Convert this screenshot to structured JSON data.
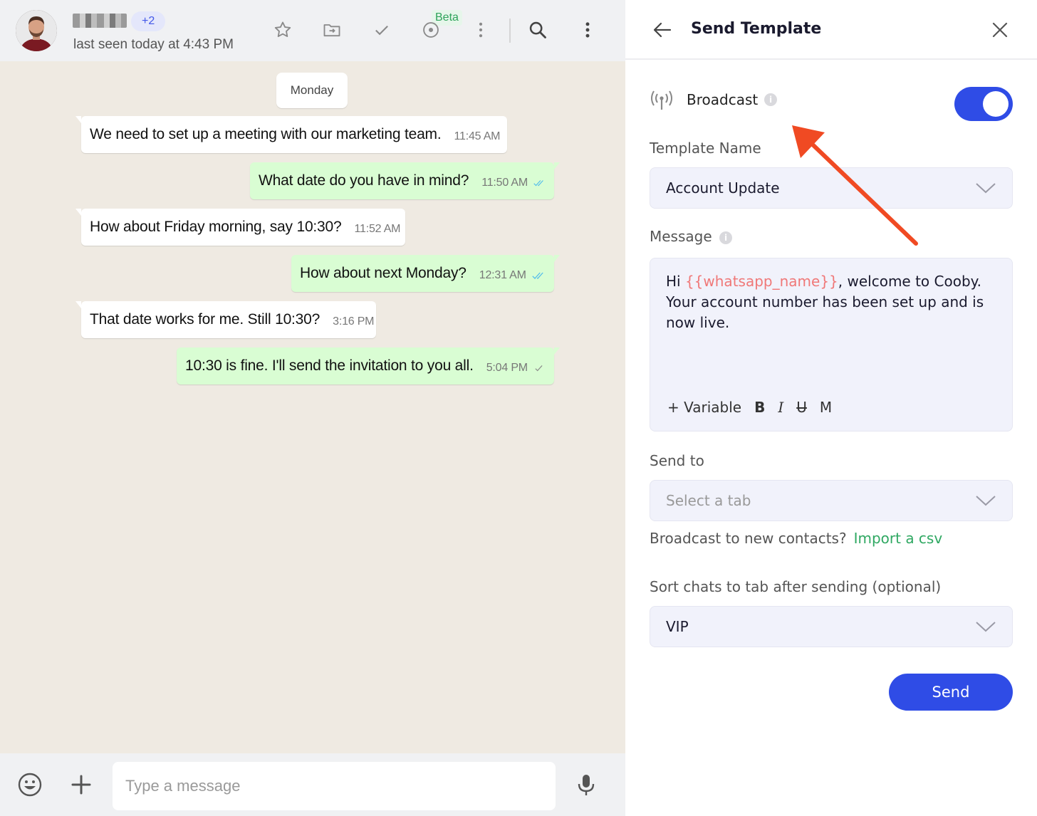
{
  "chat": {
    "header": {
      "extra_participants": "+2",
      "last_seen": "last seen today at 4:43 PM",
      "beta_label": "Beta",
      "icons": [
        "star-icon",
        "move-to-folder-icon",
        "checkmark-icon",
        "target-icon",
        "more-vertical-icon",
        "search-icon",
        "more-vertical-icon"
      ]
    },
    "day_label": "Monday",
    "messages": [
      {
        "direction": "in",
        "text": "We need to set up a meeting with our marketing team.",
        "time": "11:45 AM"
      },
      {
        "direction": "out",
        "text": "What date do you have in mind?",
        "time": "11:50 AM",
        "status": "read"
      },
      {
        "direction": "in",
        "text": "How about Friday morning, say 10:30?",
        "time": "11:52 AM"
      },
      {
        "direction": "out",
        "text": "How about next Monday?",
        "time": "12:31 AM",
        "status": "read"
      },
      {
        "direction": "in",
        "text": "That date works for me. Still 10:30?",
        "time": "3:16 PM"
      },
      {
        "direction": "out",
        "text": "10:30 is fine. I'll send the invitation to you all.",
        "time": "5:04 PM",
        "status": "sent"
      }
    ],
    "composer": {
      "placeholder": "Type a message"
    },
    "colors": {
      "incoming": "#ffffff",
      "outgoing": "#d9fdd3",
      "read_tick": "#53bdeb"
    }
  },
  "panel": {
    "title": "Send Template",
    "broadcast": {
      "label": "Broadcast",
      "enabled": true
    },
    "template_name": {
      "label": "Template Name",
      "value": "Account Update"
    },
    "message": {
      "label": "Message",
      "prefix": "Hi ",
      "variable": "{{whatsapp_name}}",
      "suffix": ", welcome to Cooby. Your account number has been set up and is now live.",
      "toolbar": {
        "variable": "+ Variable",
        "bold": "B",
        "italic": "I",
        "strike": "U",
        "mono": "M"
      }
    },
    "send_to": {
      "label": "Send to",
      "placeholder": "Select a tab"
    },
    "import": {
      "question": "Broadcast to new contacts?",
      "link": "Import a csv"
    },
    "sort": {
      "label": "Sort chats to tab after sending (optional)",
      "value": "VIP"
    },
    "send_label": "Send",
    "colors": {
      "accent": "#2f4ce6",
      "link": "#2fa862",
      "variable": "#f07878",
      "annotation_arrow": "#f04a23"
    }
  }
}
